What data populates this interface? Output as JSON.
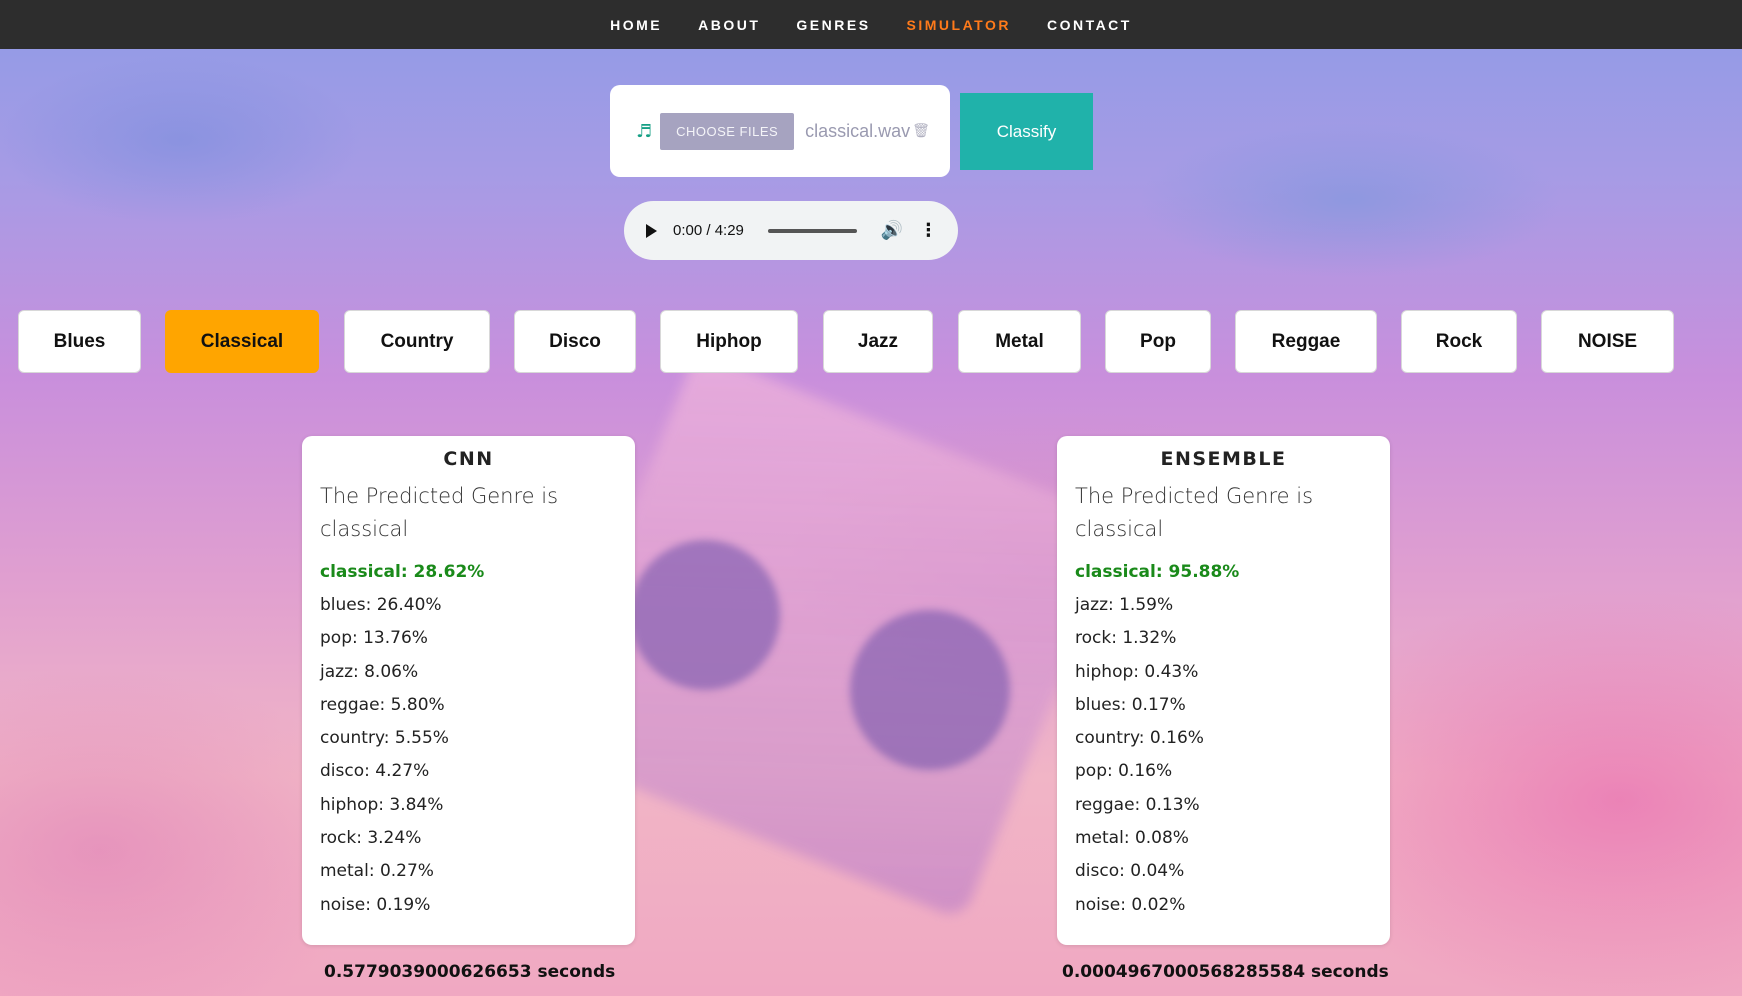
{
  "nav": {
    "items": [
      {
        "label": "HOME",
        "active": false
      },
      {
        "label": "ABOUT",
        "active": false
      },
      {
        "label": "GENRES",
        "active": false
      },
      {
        "label": "SIMULATOR",
        "active": true
      },
      {
        "label": "CONTACT",
        "active": false
      }
    ],
    "active_color": "#ff7a1a"
  },
  "upload": {
    "icon": "music-note-icon",
    "choose_label": "CHOOSE FILES",
    "file_name": "classical.wav",
    "remove_icon": "trash-icon"
  },
  "classify_label": "Classify",
  "audio": {
    "time": "0:00 / 4:29"
  },
  "genres": {
    "selected": "Classical",
    "items": [
      "Blues",
      "Classical",
      "Country",
      "Disco",
      "Hiphop",
      "Jazz",
      "Metal",
      "Pop",
      "Reggae",
      "Rock",
      "NOISE"
    ]
  },
  "results": [
    {
      "model": "CNN",
      "predicted_text": "The Predicted Genre is classical",
      "top": "classical: 28.62%",
      "scores": [
        "blues: 26.40%",
        "pop: 13.76%",
        "jazz: 8.06%",
        "reggae: 5.80%",
        "country: 5.55%",
        "disco: 4.27%",
        "hiphop: 3.84%",
        "rock: 3.24%",
        "metal: 0.27%",
        "noise: 0.19%"
      ],
      "time": "0.5779039000626653 seconds"
    },
    {
      "model": "ENSEMBLE",
      "predicted_text": "The Predicted Genre is classical",
      "top": "classical: 95.88%",
      "scores": [
        "jazz: 1.59%",
        "rock: 1.32%",
        "hiphop: 0.43%",
        "blues: 0.17%",
        "country: 0.16%",
        "pop: 0.16%",
        "reggae: 0.13%",
        "metal: 0.08%",
        "disco: 0.04%",
        "noise: 0.02%"
      ],
      "time": "0.0004967000568285584 seconds"
    }
  ],
  "colors": {
    "classify_button": "#20b2aa",
    "selected_genre": "#ffa500",
    "top_score": "#1a8a1a",
    "navbar": "#2d2d2d"
  }
}
